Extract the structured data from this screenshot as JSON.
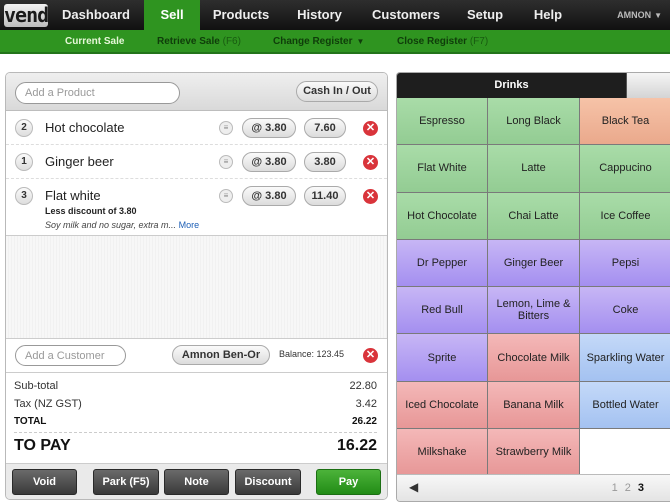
{
  "app": {
    "logo": "vend",
    "nav": [
      {
        "label": "Dashboard",
        "active": false
      },
      {
        "label": "Sell",
        "active": true
      },
      {
        "label": "Products",
        "active": false
      },
      {
        "label": "History",
        "active": false
      },
      {
        "label": "Customers",
        "active": false
      },
      {
        "label": "Setup",
        "active": false
      },
      {
        "label": "Help",
        "active": false
      }
    ],
    "user": "AMNON",
    "subnav": {
      "current_sale": "Current Sale",
      "retrieve_sale": "Retrieve Sale",
      "retrieve_key": "(F6)",
      "change_register": "Change Register",
      "close_register": "Close Register",
      "close_key": "(F7)"
    }
  },
  "sale": {
    "product_placeholder": "Add a Product",
    "cash_button": "Cash In / Out",
    "lines": [
      {
        "qty": "2",
        "name": "Hot chocolate",
        "unit_price": "@ 3.80",
        "amount": "7.60"
      },
      {
        "qty": "1",
        "name": "Ginger beer",
        "unit_price": "@ 3.80",
        "amount": "3.80"
      },
      {
        "qty": "3",
        "name": "Flat white",
        "unit_price": "@ 3.80",
        "amount": "11.40",
        "discount": "Less discount of 3.80",
        "note": "Soy milk and no sugar, extra m...",
        "more": "More"
      }
    ],
    "customer_placeholder": "Add a Customer",
    "customer_name": "Amnon Ben-Or",
    "balance": "Balance: 123.45",
    "totals": {
      "subtotal_label": "Sub-total",
      "subtotal": "22.80",
      "tax_label": "Tax (NZ GST)",
      "tax": "3.42",
      "total_label": "TOTAL",
      "total": "26.22",
      "topay_label": "TO PAY",
      "topay": "16.22"
    },
    "actions": {
      "void": "Void",
      "park": "Park (F5)",
      "note": "Note",
      "discount": "Discount",
      "pay": "Pay"
    }
  },
  "grid": {
    "tab": "Drinks",
    "tiles": [
      {
        "label": "Espresso",
        "color": "green"
      },
      {
        "label": "Long Black",
        "color": "green"
      },
      {
        "label": "Black Tea",
        "color": "orange"
      },
      {
        "label": "Flat White",
        "color": "green"
      },
      {
        "label": "Latte",
        "color": "green"
      },
      {
        "label": "Cappucino",
        "color": "green"
      },
      {
        "label": "Hot Chocolate",
        "color": "green"
      },
      {
        "label": "Chai Latte",
        "color": "green"
      },
      {
        "label": "Ice Coffee",
        "color": "green"
      },
      {
        "label": "Dr Pepper",
        "color": "purple"
      },
      {
        "label": "Ginger Beer",
        "color": "purple"
      },
      {
        "label": "Pepsi",
        "color": "purple"
      },
      {
        "label": "Red Bull",
        "color": "purple"
      },
      {
        "label": "Lemon, Lime & Bitters",
        "color": "purple"
      },
      {
        "label": "Coke",
        "color": "purple"
      },
      {
        "label": "Sprite",
        "color": "purple"
      },
      {
        "label": "Chocolate Milk",
        "color": "red"
      },
      {
        "label": "Sparkling Water",
        "color": "blue"
      },
      {
        "label": "Iced Chocolate",
        "color": "red"
      },
      {
        "label": "Banana Milk",
        "color": "red"
      },
      {
        "label": "Bottled Water",
        "color": "blue"
      },
      {
        "label": "Milkshake",
        "color": "red"
      },
      {
        "label": "Strawberry Milk",
        "color": "red"
      }
    ],
    "pages": [
      "1",
      "2",
      "3"
    ],
    "current_page": "3"
  }
}
